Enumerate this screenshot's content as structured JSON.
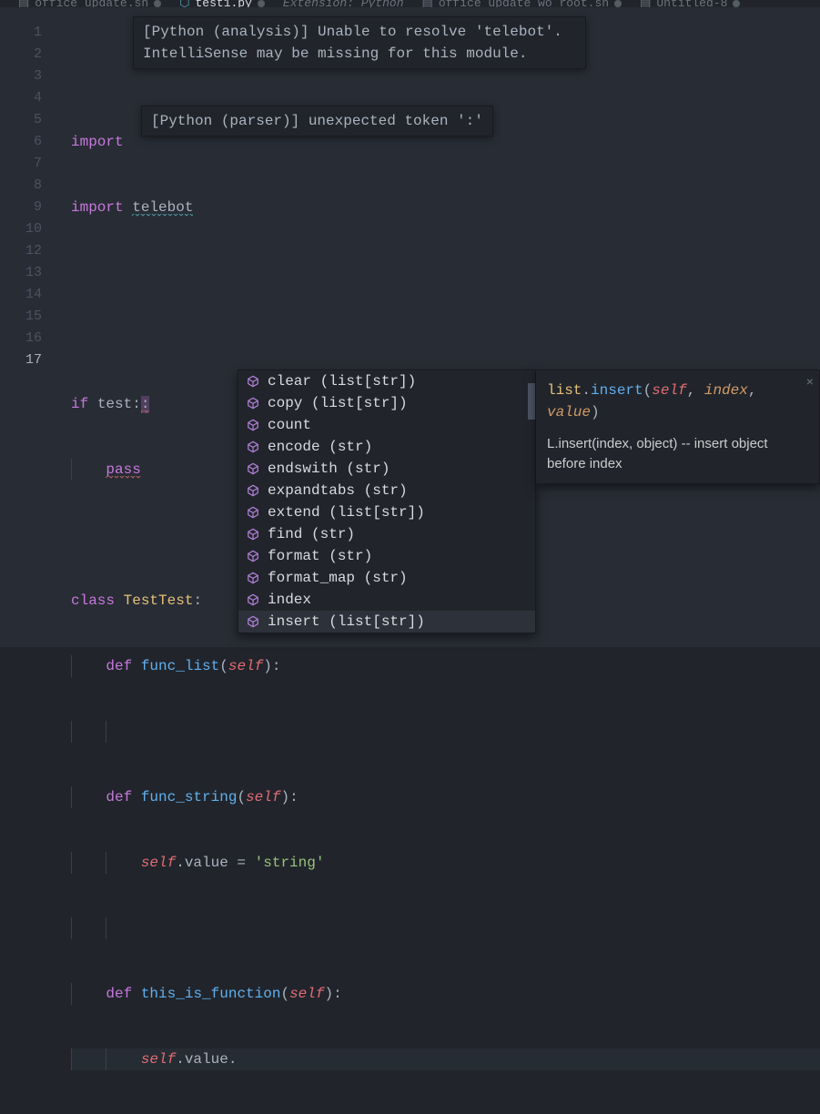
{
  "tabs": [
    {
      "label": "office_update.sh",
      "active": false,
      "dirty": true
    },
    {
      "label": "test1.py",
      "active": true,
      "dirty": true
    },
    {
      "label": "Extension: Python",
      "active": false,
      "dirty": false
    },
    {
      "label": "office_update_wo_root.sh",
      "active": false,
      "dirty": true
    },
    {
      "label": "Untitled-8",
      "active": false,
      "dirty": true
    }
  ],
  "gutter": {
    "lines": [
      "1",
      "2",
      "3",
      "4",
      "5",
      "6",
      "7",
      "8",
      "9",
      "10",
      "12",
      "13",
      "14",
      "15",
      "16",
      "17"
    ],
    "current": "17"
  },
  "code": {
    "l1": "",
    "l2_import": "import",
    "l3_import": "import",
    "l3_mod": "telebot",
    "l6_if": "if",
    "l6_cond": "test:",
    "l6_err": ":",
    "l7_pass": "pass",
    "l9_class": "class",
    "l9_name": "TestTest",
    "l9_colon": ":",
    "def": "def",
    "l10_name": "func_list",
    "l13_name": "func_string",
    "l16_name": "this_is_function",
    "self": "self",
    "l14_attr": ".value = ",
    "l14_str": "'string'",
    "l17_attr": ".value."
  },
  "hovers": {
    "top": "[Python (analysis)] Unable to resolve 'telebot'. IntelliSense may be missing for this module.",
    "mid": "[Python (parser)] unexpected token ':'"
  },
  "suggest": {
    "items": [
      {
        "label": "clear (list[str])"
      },
      {
        "label": "copy (list[str])"
      },
      {
        "label": "count"
      },
      {
        "label": "encode (str)"
      },
      {
        "label": "endswith (str)"
      },
      {
        "label": "expandtabs (str)"
      },
      {
        "label": "extend (list[str])"
      },
      {
        "label": "find (str)"
      },
      {
        "label": "format (str)"
      },
      {
        "label": "format_map (str)"
      },
      {
        "label": "index"
      },
      {
        "label": "insert (list[str])"
      }
    ],
    "selected_index": 11
  },
  "doc": {
    "sig_cls": "list",
    "sig_dot": ".",
    "sig_fn": "insert",
    "sig_open": "(",
    "sig_self": "self",
    "sig_comma1": ", ",
    "sig_arg1": "index",
    "sig_comma2": ", ",
    "sig_arg2": "value",
    "sig_close": ")",
    "desc": "L.insert(index, object) -- insert object before index"
  },
  "icons": {
    "method": "#b180d7"
  }
}
